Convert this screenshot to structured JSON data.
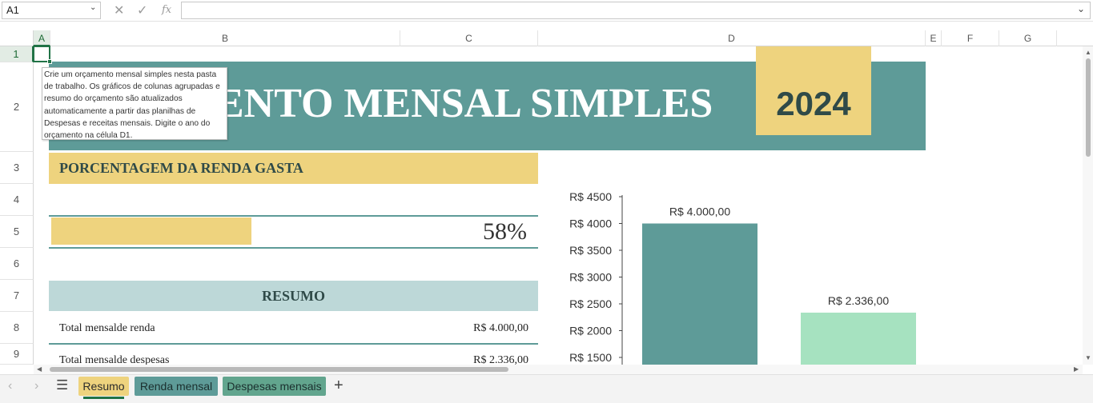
{
  "formula_bar": {
    "name_box": "A1",
    "cancel_icon": "✕",
    "enter_icon": "✓",
    "fx_label": "fx",
    "formula": ""
  },
  "columns": [
    "A",
    "B",
    "C",
    "D",
    "E",
    "F",
    "G"
  ],
  "rows": [
    "1",
    "2",
    "3",
    "4",
    "5",
    "6",
    "7",
    "8",
    "9"
  ],
  "sheet": {
    "title": "ORÇAMENTO MENSAL SIMPLES",
    "title_visible": "ENTO MENSAL SIMPLES",
    "year": "2024",
    "pct_header": "PORCENTAGEM DA RENDA GASTA",
    "pct_value": "58%",
    "pct_fraction": 0.58,
    "resumo_header": "RESUMO",
    "summary": [
      {
        "label": "Total mensalde renda",
        "value": "R$ 4.000,00"
      },
      {
        "label": "Total mensalde despesas",
        "value": "R$ 2.336,00"
      }
    ]
  },
  "tooltip": "Crie um orçamento mensal simples nesta pasta de trabalho. Os gráficos de colunas agrupadas e resumo do orçamento são atualizados automaticamente a partir das planilhas de Despesas e receitas mensais. Digite o ano do orçamento na célula D1.",
  "chart_data": {
    "type": "bar",
    "categories": [
      "",
      ""
    ],
    "values": [
      4000,
      2336
    ],
    "data_labels": [
      "R$ 4.000,00",
      "R$ 2.336,00"
    ],
    "colors": [
      "#5e9b98",
      "#a6e2c0"
    ],
    "ytick_labels": [
      "R$ 1500",
      "R$ 2000",
      "R$ 2500",
      "R$ 3000",
      "R$ 3500",
      "R$ 4000",
      "R$ 4500"
    ],
    "yticks": [
      1500,
      2000,
      2500,
      3000,
      3500,
      4000,
      4500
    ],
    "ylim_visible": [
      1500,
      4500
    ],
    "grid": false
  },
  "tabs": [
    {
      "label": "Resumo",
      "active": true
    },
    {
      "label": "Renda mensal",
      "active": false
    },
    {
      "label": "Despesas mensais",
      "active": false
    }
  ],
  "colors": {
    "teal": "#5e9b98",
    "gold": "#eed37e",
    "light_teal": "#bdd8d8",
    "mint": "#a6e2c0",
    "excel_green": "#217346"
  }
}
